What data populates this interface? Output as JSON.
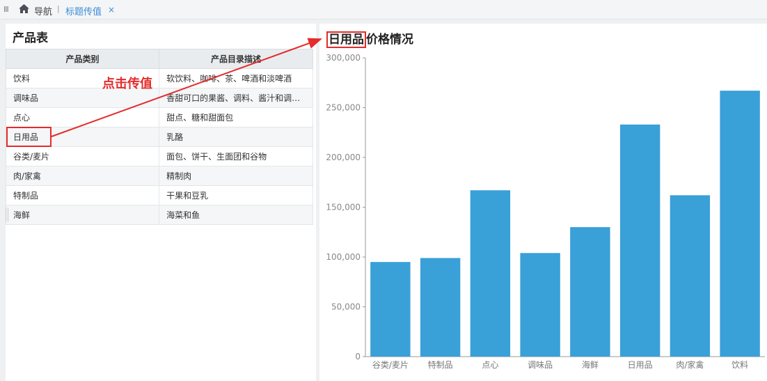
{
  "topbar": {
    "nav_label": "导航",
    "separator": "|",
    "tab_label": "标题传值",
    "close_glyph": "×",
    "grip_glyph": "III",
    "home_icon": "home-icon"
  },
  "left": {
    "title": "产品表",
    "columns": [
      "产品类别",
      "产品目录描述"
    ],
    "rows": [
      [
        "饮料",
        "软饮料、咖啡、茶、啤酒和淡啤酒"
      ],
      [
        "调味品",
        "香甜可口的果酱、调料、酱汁和调…"
      ],
      [
        "点心",
        "甜点、糖和甜面包"
      ],
      [
        "日用品",
        "乳酪"
      ],
      [
        "谷类/麦片",
        "面包、饼干、生面团和谷物"
      ],
      [
        "肉/家禽",
        "精制肉"
      ],
      [
        "特制品",
        "干果和豆乳"
      ],
      [
        "海鲜",
        "海菜和鱼"
      ]
    ]
  },
  "right": {
    "title_highlight": "日用品",
    "title_rest": "价格情况"
  },
  "annotation": {
    "label": "点击传值",
    "color": "#e52b2b"
  },
  "colors": {
    "bar": "#3aa0d8",
    "link": "#3c8dd6"
  },
  "chart_data": {
    "type": "bar",
    "categories": [
      "谷类/麦片",
      "特制品",
      "点心",
      "调味品",
      "海鲜",
      "日用品",
      "肉/家禽",
      "饮料"
    ],
    "values": [
      95000,
      99000,
      167000,
      104000,
      130000,
      233000,
      162000,
      267000
    ],
    "ylim": [
      0,
      300000
    ],
    "yticks": [
      "0",
      "50,000",
      "100,000",
      "150,000",
      "200,000",
      "250,000",
      "300,000"
    ],
    "title": "日用品价格情况",
    "grid": false,
    "legend": "none"
  }
}
